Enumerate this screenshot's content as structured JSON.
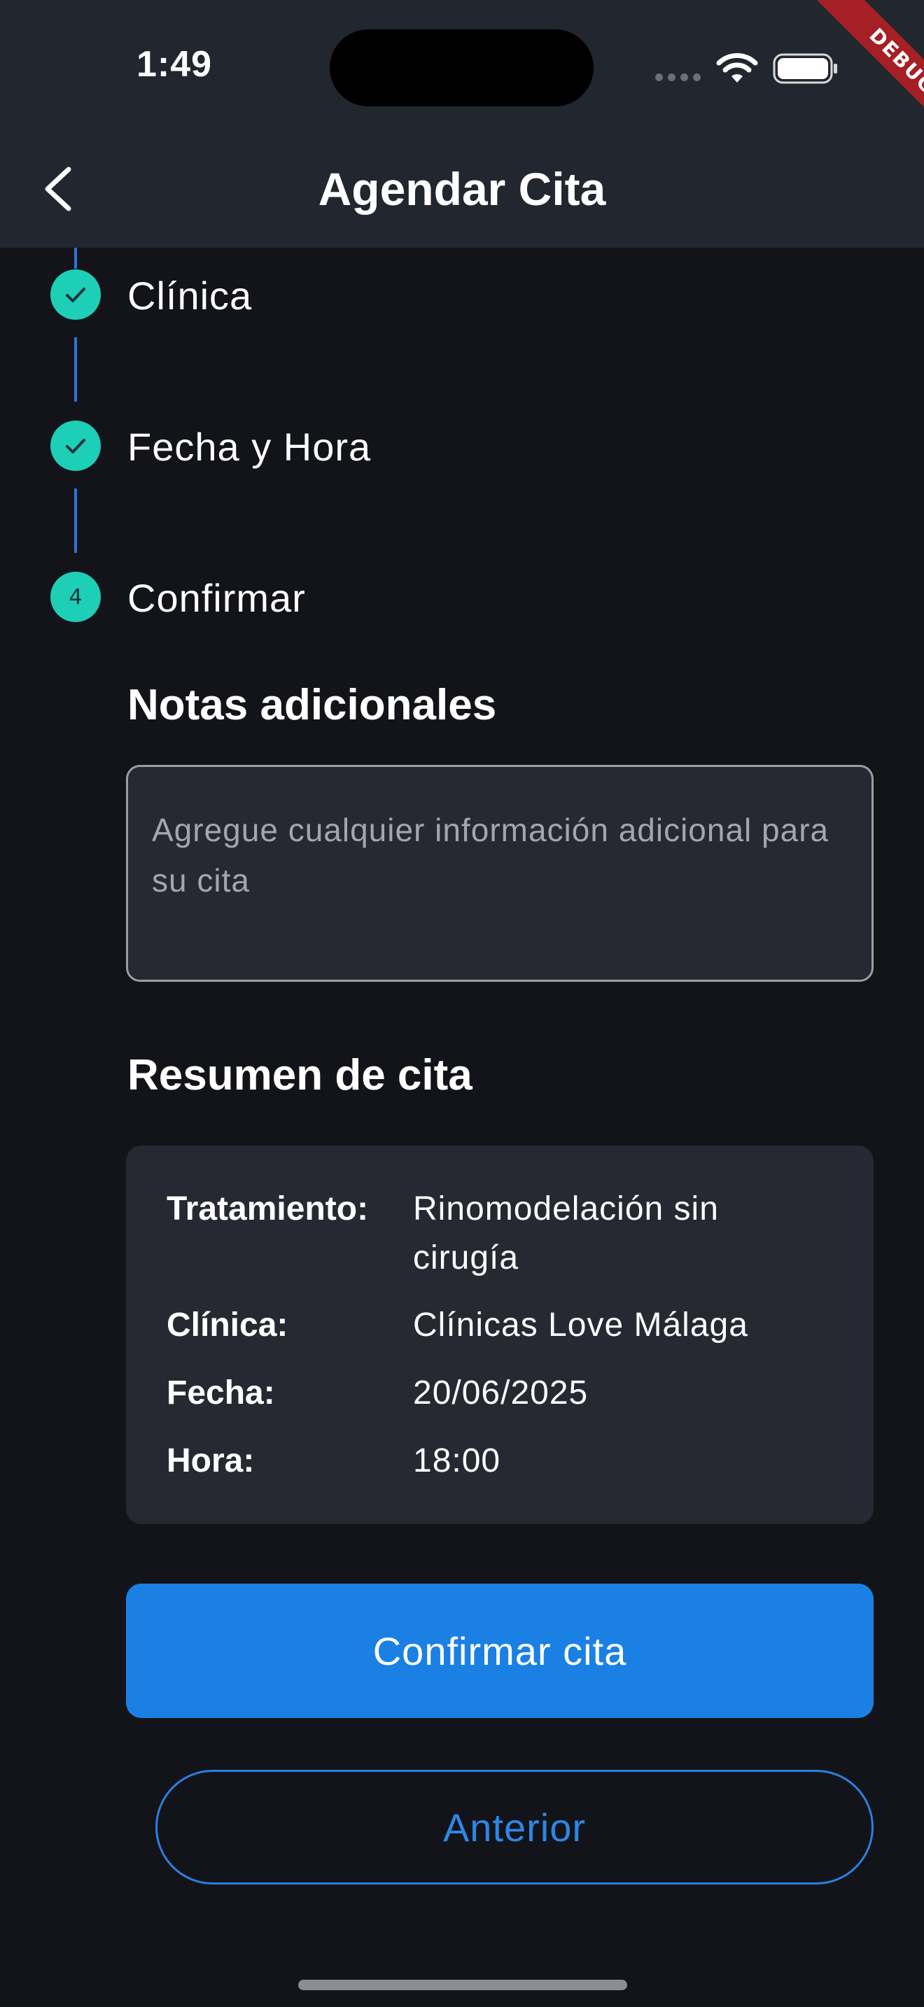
{
  "status_bar": {
    "time": "1:49",
    "debug_label": "DEBUG"
  },
  "app_bar": {
    "title": "Agendar Cita",
    "back_icon": "chevron-left-icon"
  },
  "stepper": {
    "steps": [
      {
        "label": "Clínica",
        "state": "completed",
        "icon": "check-icon"
      },
      {
        "label": "Fecha y Hora",
        "state": "completed",
        "icon": "check-icon"
      },
      {
        "label": "Confirmar",
        "state": "active",
        "number": "4"
      }
    ]
  },
  "notes": {
    "title": "Notas adicionales",
    "placeholder": "Agregue cualquier información adicional para su cita",
    "value": ""
  },
  "summary": {
    "title": "Resumen de cita",
    "rows": [
      {
        "label": "Tratamiento:",
        "value": "Rinomodelación sin cirugía"
      },
      {
        "label": "Clínica:",
        "value": "Clínicas Love Málaga"
      },
      {
        "label": "Fecha:",
        "value": "20/06/2025"
      },
      {
        "label": "Hora:",
        "value": "18:00"
      }
    ]
  },
  "actions": {
    "confirm_label": "Confirmar cita",
    "previous_label": "Anterior"
  },
  "colors": {
    "background": "#121419",
    "app_bar": "#22262e",
    "step_accent": "#1dcfb7",
    "primary": "#1b80e4",
    "card": "#262932"
  }
}
